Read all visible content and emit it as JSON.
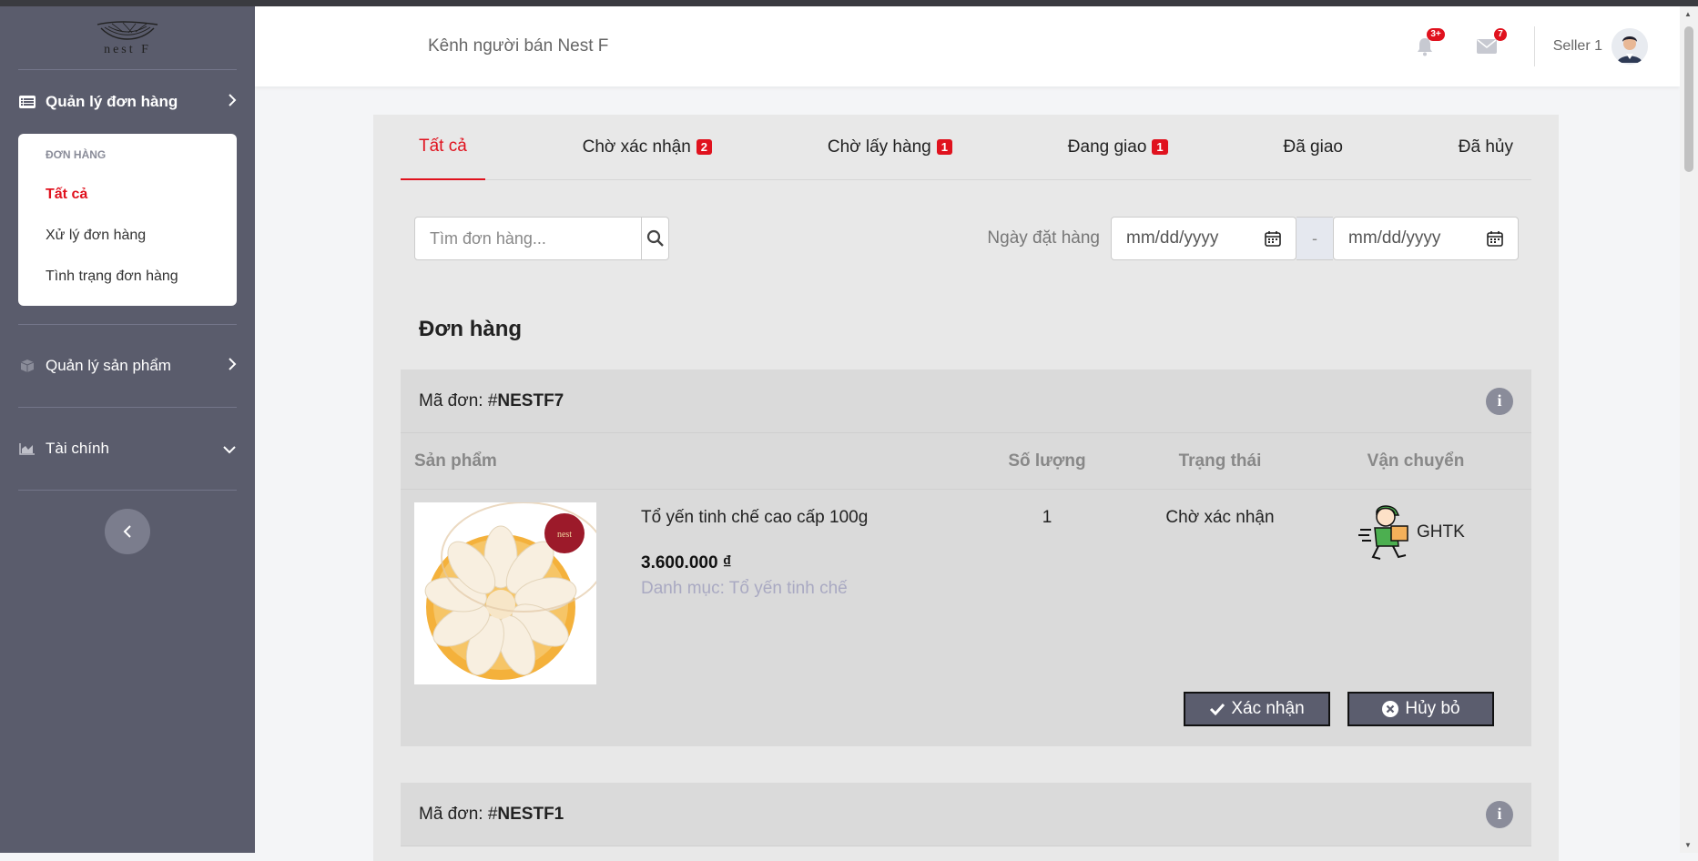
{
  "sidebar": {
    "logo_text": "nest F",
    "orders_menu": {
      "label": "Quản lý đơn hàng",
      "section_header": "ĐƠN HÀNG",
      "items": [
        {
          "label": "Tất cả"
        },
        {
          "label": "Xử lý đơn hàng"
        },
        {
          "label": "Tình trạng đơn hàng"
        }
      ]
    },
    "products_menu": {
      "label": "Quản lý sản phẩm"
    },
    "finance_menu": {
      "label": "Tài chính"
    }
  },
  "header": {
    "title": "Kênh người bán Nest F",
    "notifications_badge": "3+",
    "messages_badge": "7",
    "user_name": "Seller 1"
  },
  "tabs": [
    {
      "label": "Tất cả",
      "count": ""
    },
    {
      "label": "Chờ xác nhận",
      "count": "2"
    },
    {
      "label": "Chờ lấy hàng",
      "count": "1"
    },
    {
      "label": "Đang giao",
      "count": "1"
    },
    {
      "label": "Đã giao",
      "count": ""
    },
    {
      "label": "Đã hủy",
      "count": ""
    }
  ],
  "search": {
    "placeholder": "Tìm đơn hàng..."
  },
  "date_filter": {
    "label": "Ngày đặt hàng",
    "from_placeholder": "mm/dd/yyyy",
    "separator": "-",
    "to_placeholder": "mm/dd/yyyy"
  },
  "section_title": "Đơn hàng",
  "columns": {
    "product": "Sản phẩm",
    "quantity": "Số lượng",
    "status": "Trạng thái",
    "shipping": "Vận chuyển"
  },
  "orders": [
    {
      "code_label": "Mã đơn: #",
      "code": "NESTF7",
      "product_name": "Tổ yến tinh chế cao cấp 100g",
      "price": "3.600.000 ₫",
      "category": "Danh mục: Tổ yến tinh chế",
      "quantity": "1",
      "status": "Chờ xác nhận",
      "carrier": "GHTK",
      "confirm_label": "Xác nhận",
      "cancel_label": "Hủy bỏ"
    },
    {
      "code_label": "Mã đơn: #",
      "code": "NESTF1"
    }
  ],
  "colors": {
    "accent": "#e0121e",
    "sidebar": "#5a5c6c",
    "panel": "#e8e8e8",
    "order_bg": "#dadada"
  }
}
